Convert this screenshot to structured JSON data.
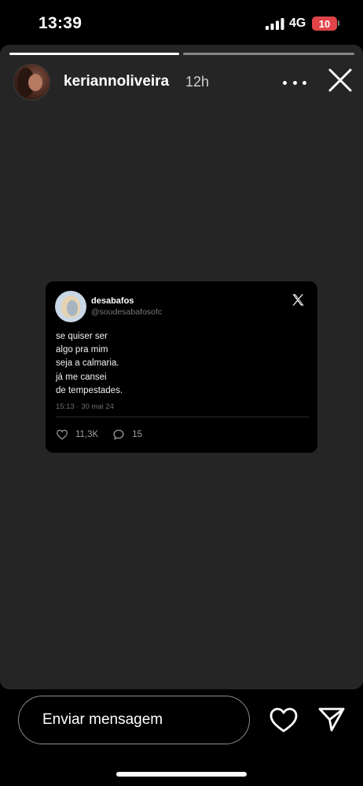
{
  "status_bar": {
    "time": "13:39",
    "network": "4G",
    "battery": "10"
  },
  "story": {
    "segments_progress": [
      1.0,
      0.0
    ],
    "username": "keriannoliveira",
    "time_ago": "12h"
  },
  "tweet": {
    "display_name": "desabafos",
    "handle": "@soudesabafosofc",
    "lines": [
      "se quiser ser",
      "algo pra mim",
      "seja a calmaria.",
      "já me cansei",
      "de tempestades."
    ],
    "timestamp": "15:13 · 30 mai 24",
    "likes": "11,3K",
    "replies": "15"
  },
  "bottom_bar": {
    "message_placeholder": "Enviar mensagem"
  },
  "icons": {
    "more": "more-horizontal-icon",
    "close": "close-icon",
    "x_logo": "x-logo-icon",
    "heart": "heart-icon",
    "comment": "comment-icon",
    "send": "send-icon"
  }
}
